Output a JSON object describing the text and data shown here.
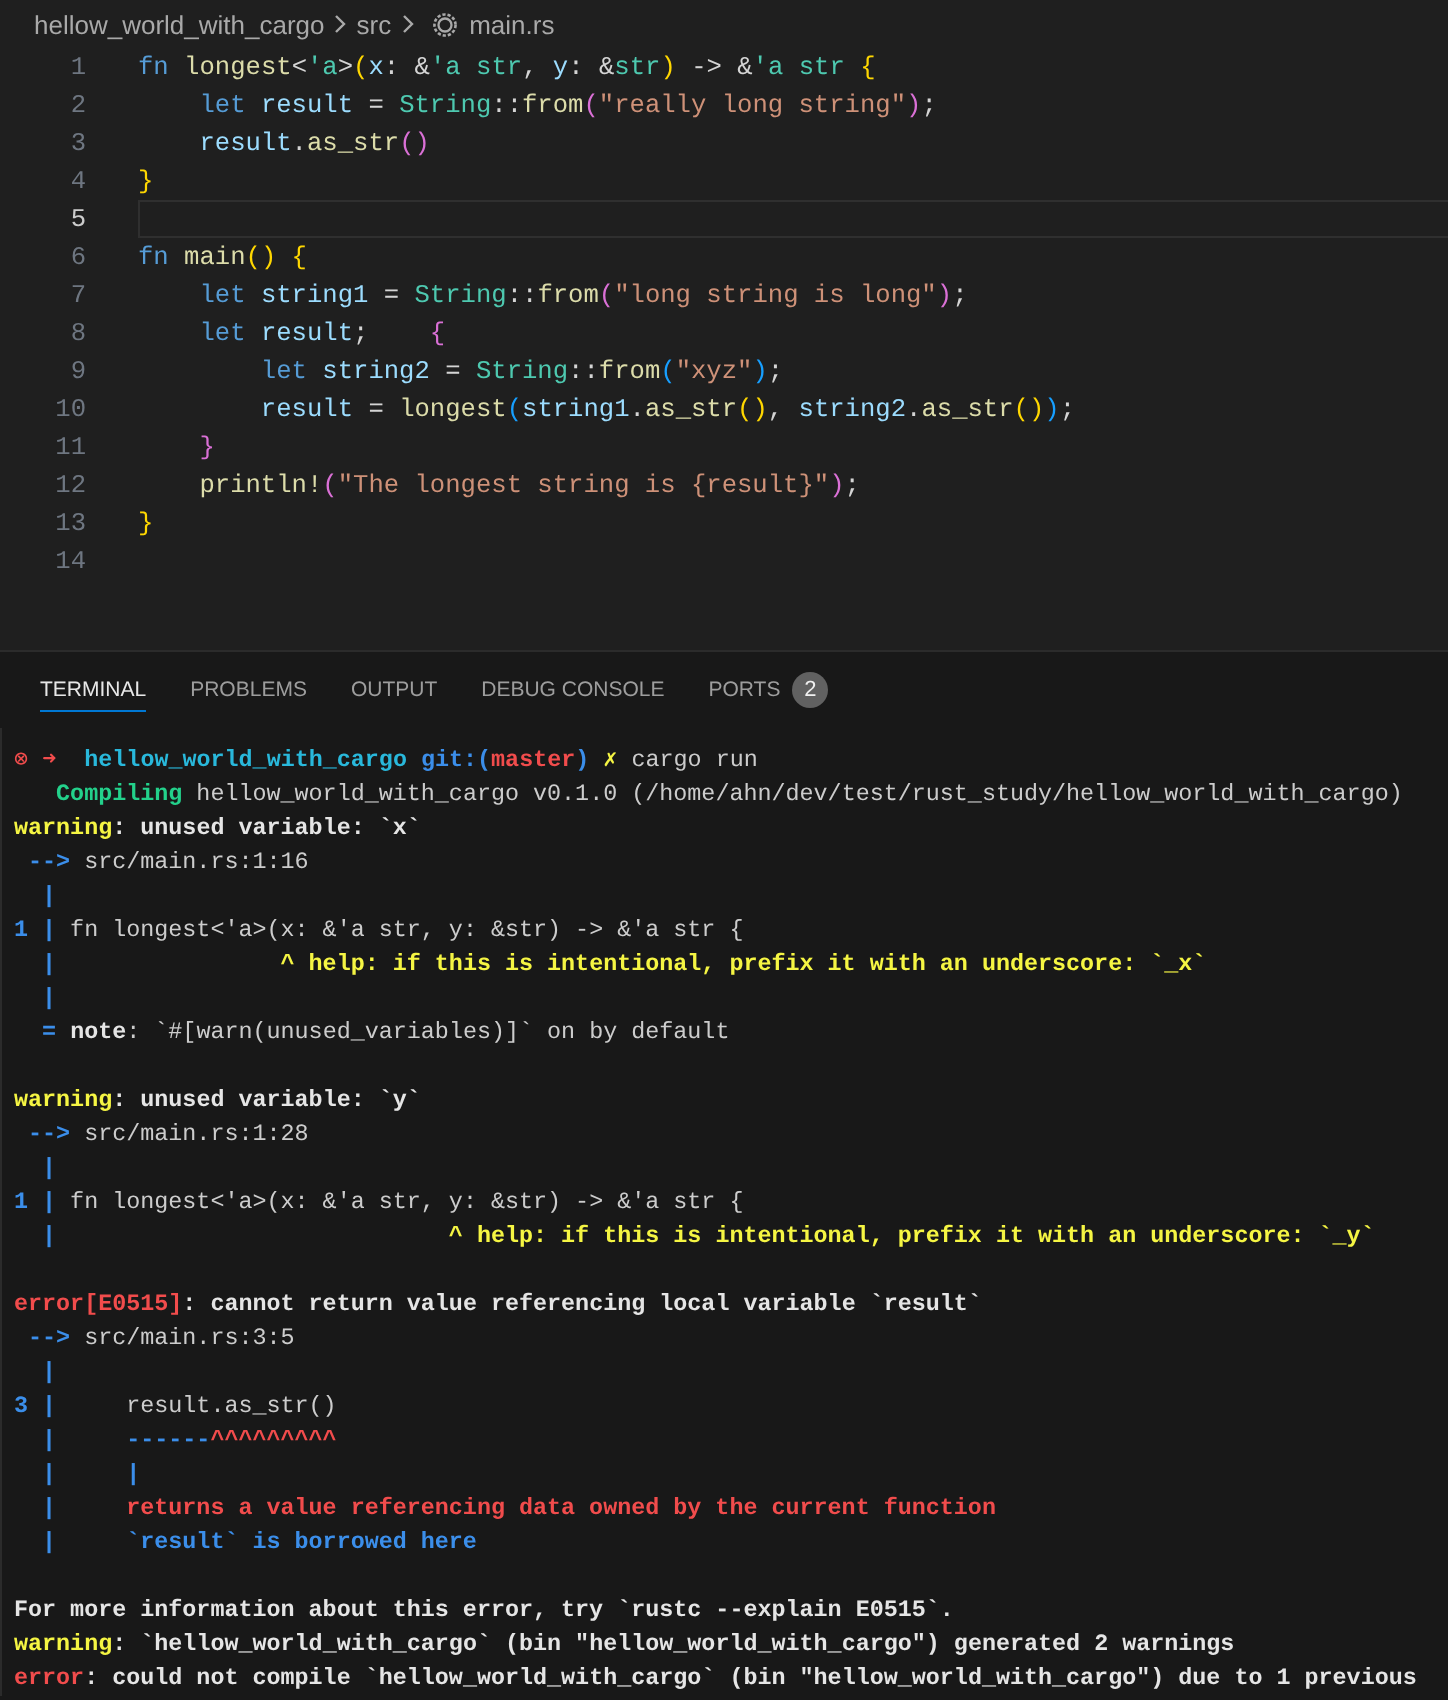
{
  "breadcrumb": {
    "items": [
      {
        "kind": "folder",
        "text": "hellow_world_with_cargo"
      },
      {
        "kind": "folder",
        "text": "src"
      },
      {
        "kind": "rust-file",
        "text": "main.rs"
      }
    ]
  },
  "editor": {
    "lines": [
      {
        "number": "1",
        "current": false,
        "tokens": [
          {
            "kind": "kw",
            "text": "fn "
          },
          {
            "kind": "fn",
            "text": "longest"
          },
          {
            "kind": "plain",
            "text": "<"
          },
          {
            "kind": "life",
            "text": "'a"
          },
          {
            "kind": "plain",
            "text": ">"
          },
          {
            "kind": "b1",
            "text": "("
          },
          {
            "kind": "var",
            "text": "x"
          },
          {
            "kind": "plain",
            "text": ": &"
          },
          {
            "kind": "life",
            "text": "'a "
          },
          {
            "kind": "type",
            "text": "str"
          },
          {
            "kind": "plain",
            "text": ", "
          },
          {
            "kind": "var",
            "text": "y"
          },
          {
            "kind": "plain",
            "text": ": &"
          },
          {
            "kind": "type",
            "text": "str"
          },
          {
            "kind": "b1",
            "text": ")"
          },
          {
            "kind": "plain",
            "text": " -> &"
          },
          {
            "kind": "life",
            "text": "'a "
          },
          {
            "kind": "type",
            "text": "str "
          },
          {
            "kind": "b1",
            "text": "{"
          }
        ]
      },
      {
        "number": "2",
        "current": false,
        "tokens": [
          {
            "kind": "kw",
            "text": "    let "
          },
          {
            "kind": "var",
            "text": "result"
          },
          {
            "kind": "plain",
            "text": " = "
          },
          {
            "kind": "type",
            "text": "String"
          },
          {
            "kind": "plain",
            "text": "::"
          },
          {
            "kind": "fn",
            "text": "from"
          },
          {
            "kind": "b2",
            "text": "("
          },
          {
            "kind": "str",
            "text": "\"really long string\""
          },
          {
            "kind": "b2",
            "text": ")"
          },
          {
            "kind": "plain",
            "text": ";"
          }
        ]
      },
      {
        "number": "3",
        "current": false,
        "tokens": [
          {
            "kind": "var",
            "text": "    result"
          },
          {
            "kind": "plain",
            "text": "."
          },
          {
            "kind": "fn",
            "text": "as_str"
          },
          {
            "kind": "b2",
            "text": "()"
          }
        ]
      },
      {
        "number": "4",
        "current": false,
        "tokens": [
          {
            "kind": "b1",
            "text": "}"
          }
        ]
      },
      {
        "number": "5",
        "current": true
      },
      {
        "number": "6",
        "current": false,
        "tokens": [
          {
            "kind": "kw",
            "text": "fn "
          },
          {
            "kind": "fn",
            "text": "main"
          },
          {
            "kind": "b1",
            "text": "()"
          },
          {
            "kind": "b1",
            "text": " {"
          }
        ]
      },
      {
        "number": "7",
        "current": false,
        "tokens": [
          {
            "kind": "kw",
            "text": "    let "
          },
          {
            "kind": "var",
            "text": "string1"
          },
          {
            "kind": "plain",
            "text": " = "
          },
          {
            "kind": "type",
            "text": "String"
          },
          {
            "kind": "plain",
            "text": "::"
          },
          {
            "kind": "fn",
            "text": "from"
          },
          {
            "kind": "b2",
            "text": "("
          },
          {
            "kind": "str",
            "text": "\"long string is long\""
          },
          {
            "kind": "b2",
            "text": ")"
          },
          {
            "kind": "plain",
            "text": ";"
          }
        ]
      },
      {
        "number": "8",
        "current": false,
        "tokens": [
          {
            "kind": "kw",
            "text": "    let "
          },
          {
            "kind": "var",
            "text": "result"
          },
          {
            "kind": "plain",
            "text": ";    "
          },
          {
            "kind": "b2",
            "text": "{"
          }
        ]
      },
      {
        "number": "9",
        "current": false,
        "tokens": [
          {
            "kind": "kw",
            "text": "        let "
          },
          {
            "kind": "var",
            "text": "string2"
          },
          {
            "kind": "plain",
            "text": " = "
          },
          {
            "kind": "type",
            "text": "String"
          },
          {
            "kind": "plain",
            "text": "::"
          },
          {
            "kind": "fn",
            "text": "from"
          },
          {
            "kind": "b3",
            "text": "("
          },
          {
            "kind": "str",
            "text": "\"xyz\""
          },
          {
            "kind": "b3",
            "text": ")"
          },
          {
            "kind": "plain",
            "text": ";"
          }
        ]
      },
      {
        "number": "10",
        "current": false,
        "tokens": [
          {
            "kind": "var",
            "text": "        result"
          },
          {
            "kind": "plain",
            "text": " = "
          },
          {
            "kind": "fn",
            "text": "longest"
          },
          {
            "kind": "b3",
            "text": "("
          },
          {
            "kind": "var",
            "text": "string1"
          },
          {
            "kind": "plain",
            "text": "."
          },
          {
            "kind": "fn",
            "text": "as_str"
          },
          {
            "kind": "b1",
            "text": "()"
          },
          {
            "kind": "plain",
            "text": ", "
          },
          {
            "kind": "var",
            "text": "string2"
          },
          {
            "kind": "plain",
            "text": "."
          },
          {
            "kind": "fn",
            "text": "as_str"
          },
          {
            "kind": "b1",
            "text": "()"
          },
          {
            "kind": "b3",
            "text": ")"
          },
          {
            "kind": "plain",
            "text": ";"
          }
        ]
      },
      {
        "number": "11",
        "current": false,
        "tokens": [
          {
            "kind": "b2",
            "text": "    }"
          }
        ]
      },
      {
        "number": "12",
        "current": false,
        "tokens": [
          {
            "kind": "fn",
            "text": "    println!"
          },
          {
            "kind": "b2",
            "text": "("
          },
          {
            "kind": "str",
            "text": "\"The longest string is {result}\""
          },
          {
            "kind": "b2",
            "text": ")"
          },
          {
            "kind": "plain",
            "text": ";"
          }
        ]
      },
      {
        "number": "13",
        "current": false,
        "tokens": [
          {
            "kind": "b1",
            "text": "}"
          }
        ]
      },
      {
        "number": "14",
        "current": false
      }
    ]
  },
  "panel": {
    "tabs": [
      {
        "label": "TERMINAL",
        "selected": true
      },
      {
        "label": "PROBLEMS",
        "selected": false
      },
      {
        "label": "OUTPUT",
        "selected": false
      },
      {
        "label": "DEBUG CONSOLE",
        "selected": false
      },
      {
        "label": "PORTS",
        "selected": false,
        "badge": "2"
      }
    ],
    "terminal": {
      "lines": [
        {
          "tokens": [
            {
              "kind": "red",
              "text": "⊗ "
            },
            {
              "kind": "red-bold",
              "text": "➜  "
            },
            {
              "kind": "cyan-bold",
              "text": "hellow_world_with_cargo "
            },
            {
              "kind": "blue-bold",
              "text": "git:("
            },
            {
              "kind": "red-bold",
              "text": "master"
            },
            {
              "kind": "blue-bold",
              "text": ") "
            },
            {
              "kind": "yellow-bold",
              "text": "✗ "
            },
            {
              "kind": "plain",
              "text": "cargo run"
            }
          ]
        },
        {
          "tokens": [
            {
              "kind": "green-bold",
              "text": "   Compiling"
            },
            {
              "kind": "plain",
              "text": " hellow_world_with_cargo v0.1.0 (/home/ahn/dev/test/rust_study/hellow_world_with_cargo)"
            }
          ]
        },
        {
          "tokens": [
            {
              "kind": "yellow-bold",
              "text": "warning"
            },
            {
              "kind": "bold",
              "text": ": unused variable: `x`"
            }
          ]
        },
        {
          "tokens": [
            {
              "kind": "blue-bold",
              "text": " --> "
            },
            {
              "kind": "plain",
              "text": "src/main.rs:1:16"
            }
          ]
        },
        {
          "tokens": [
            {
              "kind": "blue-bold",
              "text": "  |"
            }
          ]
        },
        {
          "tokens": [
            {
              "kind": "blue-bold",
              "text": "1 |"
            },
            {
              "kind": "plain",
              "text": " fn longest<'a>(x: &'a str, y: &str) -> &'a str {"
            }
          ]
        },
        {
          "tokens": [
            {
              "kind": "blue-bold",
              "text": "  |"
            },
            {
              "kind": "yellow-bold",
              "text": "                ^ help: if this is intentional, prefix it with an underscore: `_x`"
            }
          ]
        },
        {
          "tokens": [
            {
              "kind": "blue-bold",
              "text": "  |"
            }
          ]
        },
        {
          "tokens": [
            {
              "kind": "blue-bold",
              "text": "  = "
            },
            {
              "kind": "bold",
              "text": "note"
            },
            {
              "kind": "plain",
              "text": ": `#[warn(unused_variables)]` on by default"
            }
          ]
        },
        {
          "gap_before": true,
          "tokens": [
            {
              "kind": "yellow-bold",
              "text": "warning"
            },
            {
              "kind": "bold",
              "text": ": unused variable: `y`"
            }
          ]
        },
        {
          "tokens": [
            {
              "kind": "blue-bold",
              "text": " --> "
            },
            {
              "kind": "plain",
              "text": "src/main.rs:1:28"
            }
          ]
        },
        {
          "tokens": [
            {
              "kind": "blue-bold",
              "text": "  |"
            }
          ]
        },
        {
          "tokens": [
            {
              "kind": "blue-bold",
              "text": "1 |"
            },
            {
              "kind": "plain",
              "text": " fn longest<'a>(x: &'a str, y: &str) -> &'a str {"
            }
          ]
        },
        {
          "tokens": [
            {
              "kind": "blue-bold",
              "text": "  |"
            },
            {
              "kind": "yellow-bold",
              "text": "                            ^ help: if this is intentional, prefix it with an underscore: `_y`"
            }
          ]
        },
        {
          "gap_before": true,
          "tokens": [
            {
              "kind": "red-bold",
              "text": "error[E0515]"
            },
            {
              "kind": "bold",
              "text": ": cannot return value referencing local variable `result`"
            }
          ]
        },
        {
          "tokens": [
            {
              "kind": "blue-bold",
              "text": " --> "
            },
            {
              "kind": "plain",
              "text": "src/main.rs:3:5"
            }
          ]
        },
        {
          "tokens": [
            {
              "kind": "blue-bold",
              "text": "  |"
            }
          ]
        },
        {
          "tokens": [
            {
              "kind": "blue-bold",
              "text": "3 |"
            },
            {
              "kind": "plain",
              "text": "     result.as_str()"
            }
          ]
        },
        {
          "tokens": [
            {
              "kind": "blue-bold",
              "text": "  |     ------"
            },
            {
              "kind": "red-bold",
              "text": "^^^^^^^^^"
            }
          ]
        },
        {
          "tokens": [
            {
              "kind": "blue-bold",
              "text": "  |     |"
            }
          ]
        },
        {
          "tokens": [
            {
              "kind": "blue-bold",
              "text": "  |     "
            },
            {
              "kind": "red-bold",
              "text": "returns a value referencing data owned by the current function"
            }
          ]
        },
        {
          "tokens": [
            {
              "kind": "blue-bold",
              "text": "  |     `result` is borrowed here"
            }
          ]
        },
        {
          "gap_before": true,
          "tokens": [
            {
              "kind": "bold",
              "text": "For more information about this error, try `rustc --explain E0515`."
            }
          ]
        },
        {
          "tokens": [
            {
              "kind": "yellow-bold",
              "text": "warning"
            },
            {
              "kind": "bold",
              "text": ": `hellow_world_with_cargo` (bin \"hellow_world_with_cargo\") generated 2 warnings"
            }
          ]
        },
        {
          "tokens": [
            {
              "kind": "red-bold",
              "text": "error"
            },
            {
              "kind": "bold",
              "text": ": could not compile `hellow_world_with_cargo` (bin \"hellow_world_with_cargo\") due to 1 previous"
            }
          ]
        }
      ]
    }
  }
}
